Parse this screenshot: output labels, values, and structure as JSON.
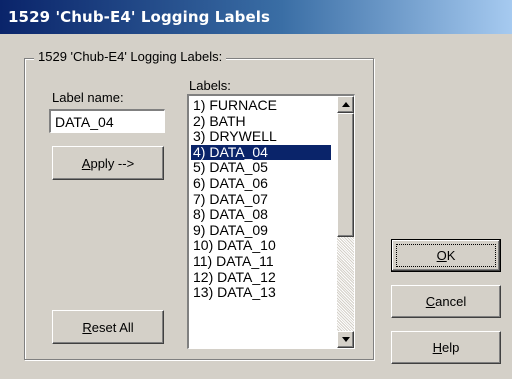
{
  "window": {
    "title": "1529 'Chub-E4' Logging Labels"
  },
  "group": {
    "title": "1529 'Chub-E4' Logging Labels:"
  },
  "label_name": {
    "caption": "Label name:",
    "value": "DATA_04"
  },
  "labels": {
    "caption": "Labels:",
    "items": [
      "1) FURNACE",
      "2) BATH",
      "3) DRYWELL",
      "4) DATA_04",
      "5) DATA_05",
      "6) DATA_06",
      "7) DATA_07",
      "8) DATA_08",
      "9) DATA_09",
      "10) DATA_10",
      "11) DATA_11",
      "12) DATA_12",
      "13) DATA_13"
    ],
    "selected_index": 3
  },
  "buttons": {
    "apply": {
      "mnemonic": "A",
      "rest": "pply -->"
    },
    "reset_all": {
      "mnemonic": "R",
      "rest": "eset All"
    },
    "ok": {
      "mnemonic": "O",
      "rest": "K"
    },
    "cancel": {
      "mnemonic": "C",
      "rest": "ancel"
    },
    "help": {
      "mnemonic": "H",
      "rest": "elp"
    }
  },
  "colors": {
    "title_bar": "#0a246a",
    "selection": "#0a246a",
    "face": "#d4d0c8"
  }
}
